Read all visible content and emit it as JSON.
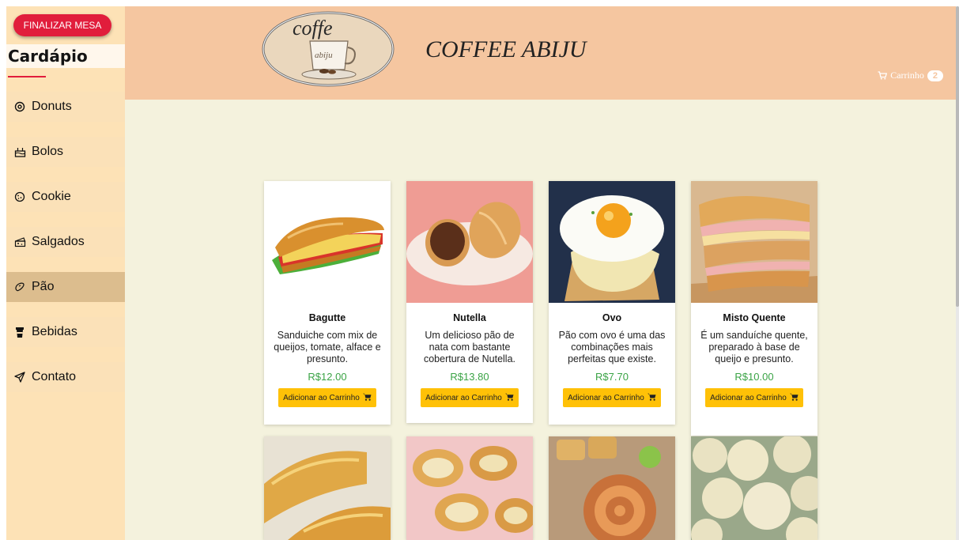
{
  "sidebar": {
    "finalize_label": "FINALIZAR MESA",
    "title": "Cardápio",
    "items": [
      {
        "label": "Donuts",
        "icon": "donut-icon",
        "active": false
      },
      {
        "label": "Bolos",
        "icon": "cake-icon",
        "active": false
      },
      {
        "label": "Cookie",
        "icon": "cookie-icon",
        "active": false
      },
      {
        "label": "Salgados",
        "icon": "cheese-icon",
        "active": false
      },
      {
        "label": "Pão",
        "icon": "bread-icon",
        "active": true
      },
      {
        "label": "Bebidas",
        "icon": "cup-icon",
        "active": false
      },
      {
        "label": "Contato",
        "icon": "send-icon",
        "active": false
      }
    ]
  },
  "header": {
    "logo_text_top": "coffe",
    "logo_text_cup": "abiju",
    "brand": "COFFEE ABIJU",
    "cart_label": "Carrinho",
    "cart_count": "2"
  },
  "products": [
    {
      "name": "Bagutte",
      "desc": "Sanduiche com mix de queijos, tomate, alface e presunto.",
      "price": "R$12.00",
      "button": "Adicionar ao Carrinho"
    },
    {
      "name": "Nutella",
      "desc": "Um delicioso pão de nata com bastante cobertura de Nutella.",
      "price": "R$13.80",
      "button": "Adicionar ao Carrinho"
    },
    {
      "name": "Ovo",
      "desc": "Pão com ovo é uma das combinações mais perfeitas que existe.",
      "price": "R$7.70",
      "button": "Adicionar ao Carrinho"
    },
    {
      "name": "Misto Quente",
      "desc": "É um sanduíche quente, preparado à base de queijo e presunto.",
      "price": "R$10.00",
      "button": "Adicionar ao Carrinho"
    }
  ],
  "colors": {
    "accent": "#e11d3c",
    "sidebar_bg": "#fde2b6",
    "header_bg": "#f5c6a0",
    "main_bg": "#f4f2dd",
    "button_yellow": "#ffc107",
    "price_green": "#3aa345"
  }
}
